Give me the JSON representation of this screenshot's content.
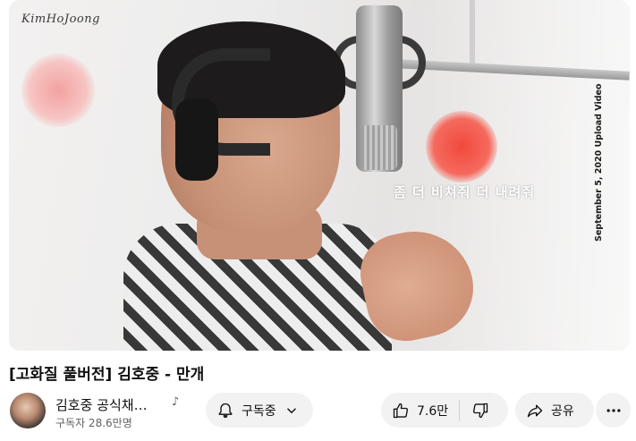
{
  "video": {
    "watermark": "KimHoJoong",
    "lyric_overlay": "좀 더 비쳐줘 더 내려줘",
    "side_caption": "September 5, 2020 Upload Video"
  },
  "title": "[고화질 풀버전] 김호중 - 만개",
  "channel": {
    "name": "김호중 공식채…",
    "subscribers": "구독자 28.6만명"
  },
  "actions": {
    "subscribe_label": "구독중",
    "like_count": "7.6만",
    "share_label": "공유"
  },
  "icons": {
    "note": "music-note-icon",
    "bell": "bell-icon",
    "chevron": "chevron-down-icon",
    "like": "thumbs-up-icon",
    "dislike": "thumbs-down-icon",
    "share": "share-icon",
    "more": "more-horizontal-icon"
  }
}
